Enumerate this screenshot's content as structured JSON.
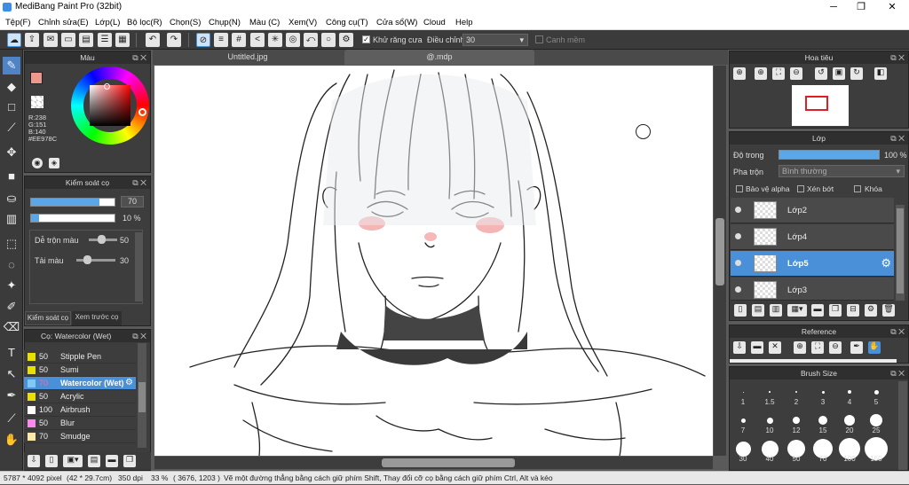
{
  "window": {
    "title": "MediBang Paint Pro (32bit)"
  },
  "menu": [
    "Tệp(F)",
    "Chỉnh sửa(E)",
    "Lớp(L)",
    "Bộ lọc(R)",
    "Chọn(S)",
    "Chụp(N)",
    "Màu (C)",
    "Xem(V)",
    "Công cụ(T)",
    "Cửa sổ(W)",
    "Cloud",
    "Help"
  ],
  "toolbar": {
    "antialias_label": "Khử răng cưa",
    "adjust_label": "Điều chỉnh",
    "adjust_value": "30",
    "edge_label": "Canh mềm"
  },
  "color_panel": {
    "title": "Màu",
    "r": "R:238",
    "g": "G:151",
    "b": "B:140",
    "hex": "#EE978C",
    "fg_color": "#EE978C"
  },
  "brush_control": {
    "title": "Kiểm soát cọ",
    "size_value": "70",
    "opacity_value": "10 %",
    "blend_label": "Dễ trộn màu",
    "blend_value": "50",
    "reload_label": "Tải màu",
    "reload_value": "30",
    "tab1": "Kiểm soát cọ",
    "tab2": "Xem trước cọ"
  },
  "brush_list": {
    "title": "Cọ: Watercolor (Wet)",
    "items": [
      {
        "size": "50",
        "name": "Stipple Pen",
        "color": "#e8e000"
      },
      {
        "size": "50",
        "name": "Sumi",
        "color": "#e8e000"
      },
      {
        "size": "70",
        "name": "Watercolor (Wet)",
        "color": "#7fc8f8"
      },
      {
        "size": "50",
        "name": "Acrylic",
        "color": "#e8e000"
      },
      {
        "size": "100",
        "name": "Airbrush",
        "color": "#ffffff"
      },
      {
        "size": "50",
        "name": "Blur",
        "color": "#ff88ee"
      },
      {
        "size": "70",
        "name": "Smudge",
        "color": "#ffe9a8"
      }
    ]
  },
  "tabs": [
    "Untitled.jpg",
    "@.mdp"
  ],
  "navigator": {
    "title": "Hoa tiêu"
  },
  "layers": {
    "title": "Lớp",
    "opacity_label": "Độ trong",
    "opacity_value": "100 %",
    "blend_label": "Pha trộn",
    "blend_value": "Bình thường",
    "protect_alpha": "Bảo vệ alpha",
    "clipping": "Xén bớt",
    "lock": "Khóa",
    "items": [
      {
        "name": "Lớp2",
        "selected": false
      },
      {
        "name": "Lớp4",
        "selected": false
      },
      {
        "name": "Lớp5",
        "selected": true
      },
      {
        "name": "Lớp3",
        "selected": false
      }
    ]
  },
  "reference": {
    "title": "Reference"
  },
  "brush_size": {
    "title": "Brush Size",
    "sizes": [
      "1",
      "1.5",
      "2",
      "3",
      "4",
      "5",
      "7",
      "10",
      "12",
      "15",
      "20",
      "25",
      "30",
      "40",
      "50",
      "70",
      "100",
      "150"
    ]
  },
  "status": {
    "dimensions": "5787 * 4092 pixel",
    "physical": "(42 * 29.7cm)",
    "dpi": "350 dpi",
    "zoom": "33 %",
    "coords": "( 3676, 1203 )",
    "hint": "Vẽ một đường thẳng bằng cách giữ phím Shift, Thay đổi cỡ cọ bằng cách giữ phím Ctrl, Alt và kéo"
  }
}
